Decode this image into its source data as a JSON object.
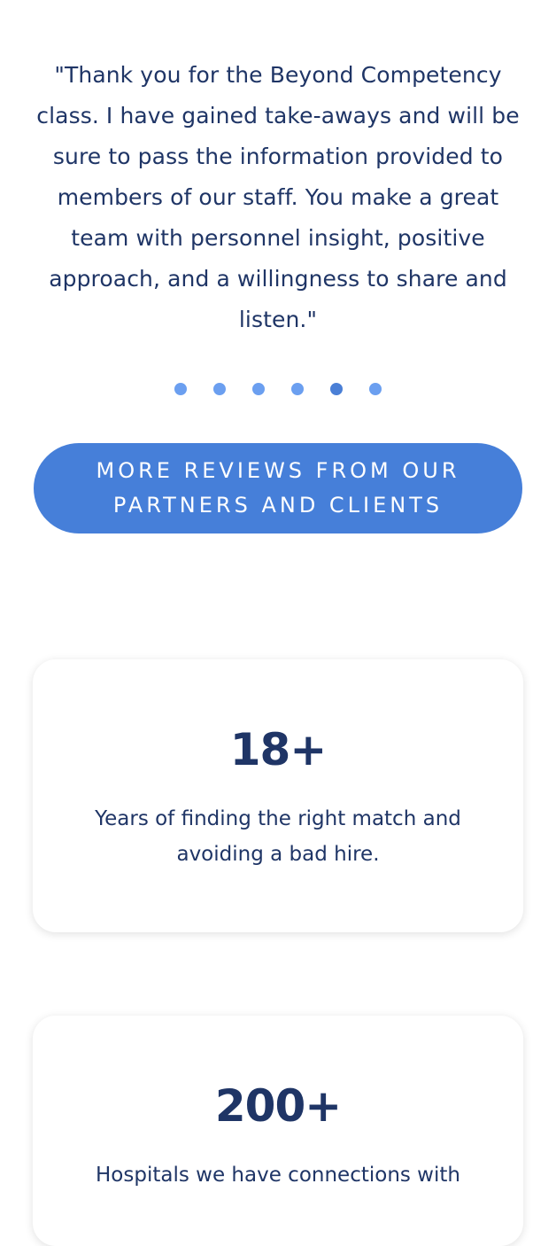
{
  "testimonial": {
    "quote": "\"Thank you for the Beyond Competency class. I have gained take-aways and will be sure to pass the information provided to members of our staff. You make a great team with personnel insight, positive approach, and a willingness to share and listen.\""
  },
  "carousel": {
    "dot_count": 6,
    "active_index": 4
  },
  "cta": {
    "label": "MORE REVIEWS FROM OUR PARTNERS AND CLIENTS"
  },
  "stats": [
    {
      "number": "18+",
      "text": "Years of finding the right match and avoiding a bad hire."
    },
    {
      "number": "200+",
      "text": "Hospitals we have connections with"
    }
  ],
  "colors": {
    "text": "#1f3566",
    "accent": "#467fd9",
    "dot": "#6b9ff0",
    "dot_active": "#4a7fd6"
  }
}
